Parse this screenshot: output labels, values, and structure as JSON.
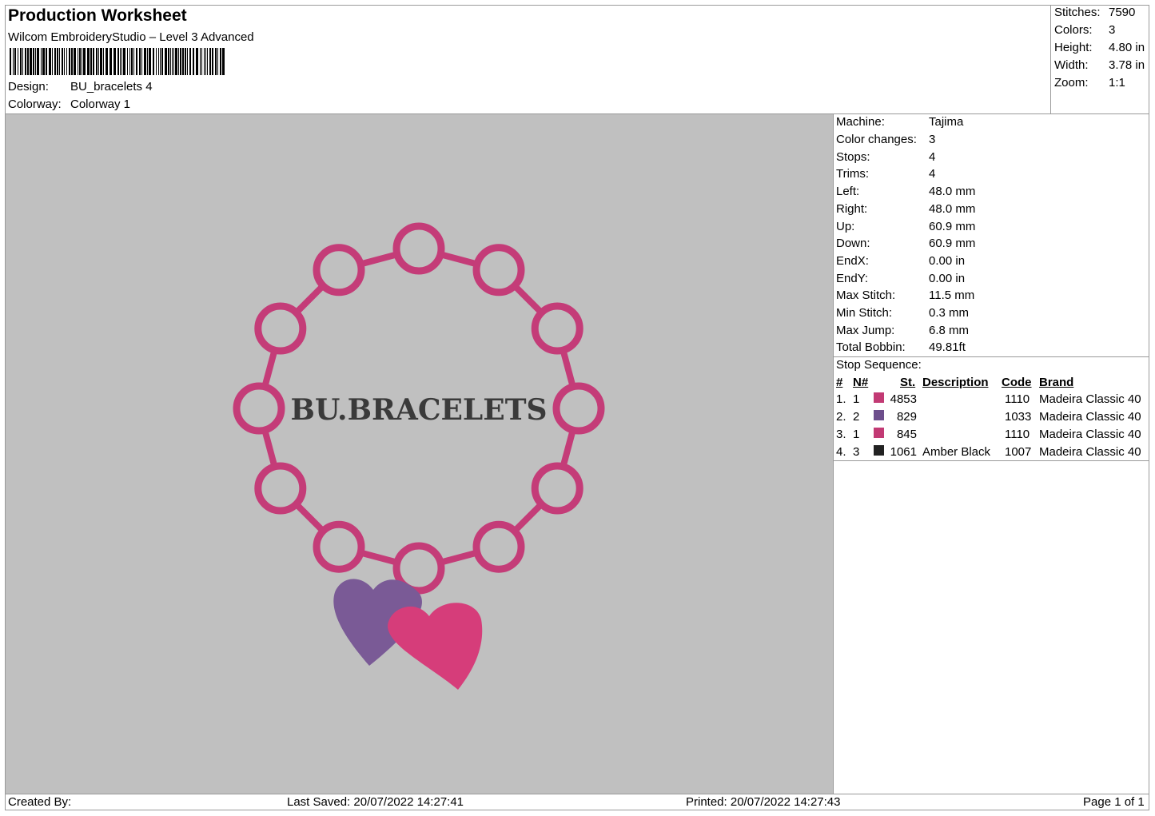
{
  "header": {
    "title": "Production Worksheet",
    "software": "Wilcom EmbroideryStudio – Level 3 Advanced",
    "design_label": "Design:",
    "design_value": "BU_bracelets 4",
    "colorway_label": "Colorway:",
    "colorway_value": "Colorway 1"
  },
  "summary": [
    {
      "label": "Stitches:",
      "value": "7590"
    },
    {
      "label": "Colors:",
      "value": "3"
    },
    {
      "label": "Height:",
      "value": "4.80 in"
    },
    {
      "label": "Width:",
      "value": "3.78 in"
    },
    {
      "label": "Zoom:",
      "value": "1:1"
    }
  ],
  "machine_info": [
    {
      "label": "Machine:",
      "value": "Tajima"
    },
    {
      "label": "Color changes:",
      "value": "3"
    },
    {
      "label": "Stops:",
      "value": "4"
    },
    {
      "label": "Trims:",
      "value": "4"
    },
    {
      "label": "Left:",
      "value": "48.0 mm"
    },
    {
      "label": "Right:",
      "value": "48.0 mm"
    },
    {
      "label": "Up:",
      "value": "60.9 mm"
    },
    {
      "label": "Down:",
      "value": "60.9 mm"
    },
    {
      "label": "EndX:",
      "value": "0.00 in"
    },
    {
      "label": "EndY:",
      "value": "0.00 in"
    },
    {
      "label": "Max Stitch:",
      "value": "11.5 mm"
    },
    {
      "label": "Min Stitch:",
      "value": "0.3 mm"
    },
    {
      "label": "Max Jump:",
      "value": "6.8 mm"
    },
    {
      "label": "Total Bobbin:",
      "value": "49.81ft"
    }
  ],
  "stop_sequence": {
    "title": "Stop Sequence:",
    "headers": {
      "num": "#",
      "n": "N#",
      "st": "St.",
      "description": "Description",
      "code": "Code",
      "brand": "Brand"
    },
    "rows": [
      {
        "num": "1.",
        "n": "1",
        "color": "#c23a74",
        "st": "4853",
        "description": "",
        "code": "1110",
        "brand": "Madeira Classic 40"
      },
      {
        "num": "2.",
        "n": "2",
        "color": "#6d4e8c",
        "st": "829",
        "description": "",
        "code": "1033",
        "brand": "Madeira Classic 40"
      },
      {
        "num": "3.",
        "n": "1",
        "color": "#c23a74",
        "st": "845",
        "description": "",
        "code": "1110",
        "brand": "Madeira Classic 40"
      },
      {
        "num": "4.",
        "n": "3",
        "color": "#222222",
        "st": "1061",
        "description": "Amber Black",
        "code": "1007",
        "brand": "Madeira Classic 40"
      }
    ]
  },
  "design_preview": {
    "text": "BU.BRACELETS",
    "ring_color": "#c43c78",
    "heart_back_color": "#7a5a96",
    "heart_front_color": "#d63d7a",
    "text_color": "#3a3a3a",
    "background": "#c0c0c0"
  },
  "footer": {
    "created_by": "Created By:",
    "last_saved": "Last Saved: 20/07/2022 14:27:41",
    "printed": "Printed: 20/07/2022 14:27:43",
    "page": "Page 1 of 1"
  }
}
